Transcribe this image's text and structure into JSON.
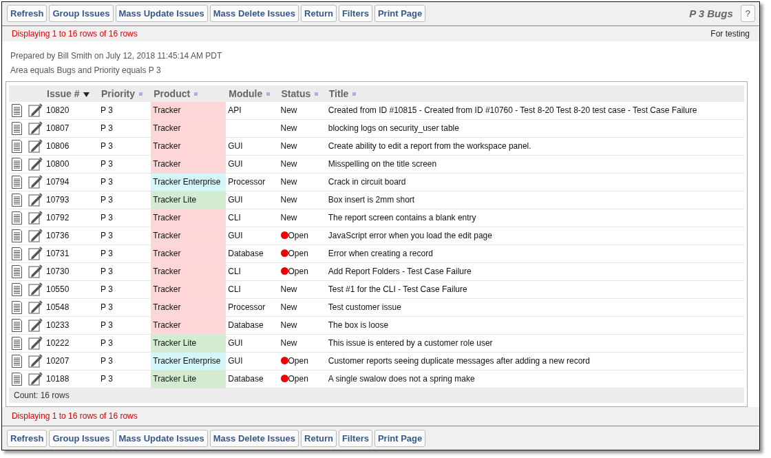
{
  "toolbar_top": {
    "buttons": [
      "Refresh",
      "Group Issues",
      "Mass Update Issues",
      "Mass Delete Issues",
      "Return",
      "Filters",
      "Print Page"
    ],
    "title": "P 3 Bugs",
    "help": "?"
  },
  "status_top": {
    "message": "Displaying 1 to 16 rows of 16 rows",
    "note": "For testing"
  },
  "prepared": "Prepared by Bill Smith on July 12, 2018 11:45:14 AM PDT",
  "filter": "Area equals Bugs and Priority equals P 3",
  "table": {
    "columns": [
      {
        "label": "Issue #",
        "sorted": true
      },
      {
        "label": "Priority",
        "sorted": false
      },
      {
        "label": "Product",
        "sorted": false
      },
      {
        "label": "Module",
        "sorted": false
      },
      {
        "label": "Status",
        "sorted": false
      },
      {
        "label": "Title",
        "sorted": false
      }
    ],
    "rows": [
      {
        "id": "10820",
        "priority": "P 3",
        "product": "Tracker",
        "color": "#fdd7d7",
        "module": "API",
        "status": "New",
        "flagged": false,
        "title": "Created from ID #10815 - Created from ID #10760 - Test 8-20 Test 8-20 test case - Test Case Failure"
      },
      {
        "id": "10807",
        "priority": "P 3",
        "product": "Tracker",
        "color": "#fdd7d7",
        "module": "",
        "status": "New",
        "flagged": false,
        "title": "blocking logs on security_user table"
      },
      {
        "id": "10806",
        "priority": "P 3",
        "product": "Tracker",
        "color": "#fdd7d7",
        "module": "GUI",
        "status": "New",
        "flagged": false,
        "title": "Create ability to edit a report from the workspace panel."
      },
      {
        "id": "10800",
        "priority": "P 3",
        "product": "Tracker",
        "color": "#fdd7d7",
        "module": "GUI",
        "status": "New",
        "flagged": false,
        "title": "Misspelling on the title screen"
      },
      {
        "id": "10794",
        "priority": "P 3",
        "product": "Tracker Enterprise",
        "color": "#d5f6f8",
        "module": "Processor",
        "status": "New",
        "flagged": false,
        "title": "Crack in circuit board"
      },
      {
        "id": "10793",
        "priority": "P 3",
        "product": "Tracker Lite",
        "color": "#d3ecd1",
        "module": "GUI",
        "status": "New",
        "flagged": false,
        "title": "Box insert is 2mm short"
      },
      {
        "id": "10792",
        "priority": "P 3",
        "product": "Tracker",
        "color": "#fdd7d7",
        "module": "CLI",
        "status": "New",
        "flagged": false,
        "title": "The report screen contains a blank entry"
      },
      {
        "id": "10736",
        "priority": "P 3",
        "product": "Tracker",
        "color": "#fdd7d7",
        "module": "GUI",
        "status": "Open",
        "flagged": true,
        "title": "JavaScript error when you load the edit page"
      },
      {
        "id": "10731",
        "priority": "P 3",
        "product": "Tracker",
        "color": "#fdd7d7",
        "module": "Database",
        "status": "Open",
        "flagged": true,
        "title": "Error when creating a record"
      },
      {
        "id": "10730",
        "priority": "P 3",
        "product": "Tracker",
        "color": "#fdd7d7",
        "module": "CLI",
        "status": "Open",
        "flagged": true,
        "title": "Add Report Folders - Test Case Failure"
      },
      {
        "id": "10550",
        "priority": "P 3",
        "product": "Tracker",
        "color": "#fdd7d7",
        "module": "CLI",
        "status": "New",
        "flagged": false,
        "title": "Test #1 for the CLI - Test Case Failure"
      },
      {
        "id": "10548",
        "priority": "P 3",
        "product": "Tracker",
        "color": "#fdd7d7",
        "module": "Processor",
        "status": "New",
        "flagged": false,
        "title": "Test customer issue"
      },
      {
        "id": "10233",
        "priority": "P 3",
        "product": "Tracker",
        "color": "#fdd7d7",
        "module": "Database",
        "status": "New",
        "flagged": false,
        "title": "The box is loose"
      },
      {
        "id": "10222",
        "priority": "P 3",
        "product": "Tracker Lite",
        "color": "#d3ecd1",
        "module": "GUI",
        "status": "New",
        "flagged": false,
        "title": "This issue is entered by a customer role user"
      },
      {
        "id": "10207",
        "priority": "P 3",
        "product": "Tracker Enterprise",
        "color": "#d5f6f8",
        "module": "GUI",
        "status": "Open",
        "flagged": true,
        "title": "Customer reports seeing duplicate messages after adding a new record"
      },
      {
        "id": "10188",
        "priority": "P 3",
        "product": "Tracker Lite",
        "color": "#d3ecd1",
        "module": "Database",
        "status": "Open",
        "flagged": true,
        "title": "A single swalow does not a spring make"
      }
    ],
    "count": "Count: 16 rows"
  },
  "status_bottom": {
    "message": "Displaying 1 to 16 rows of 16 rows"
  },
  "toolbar_bottom": {
    "buttons": [
      "Refresh",
      "Group Issues",
      "Mass Update Issues",
      "Mass Delete Issues",
      "Return",
      "Filters",
      "Print Page"
    ]
  }
}
